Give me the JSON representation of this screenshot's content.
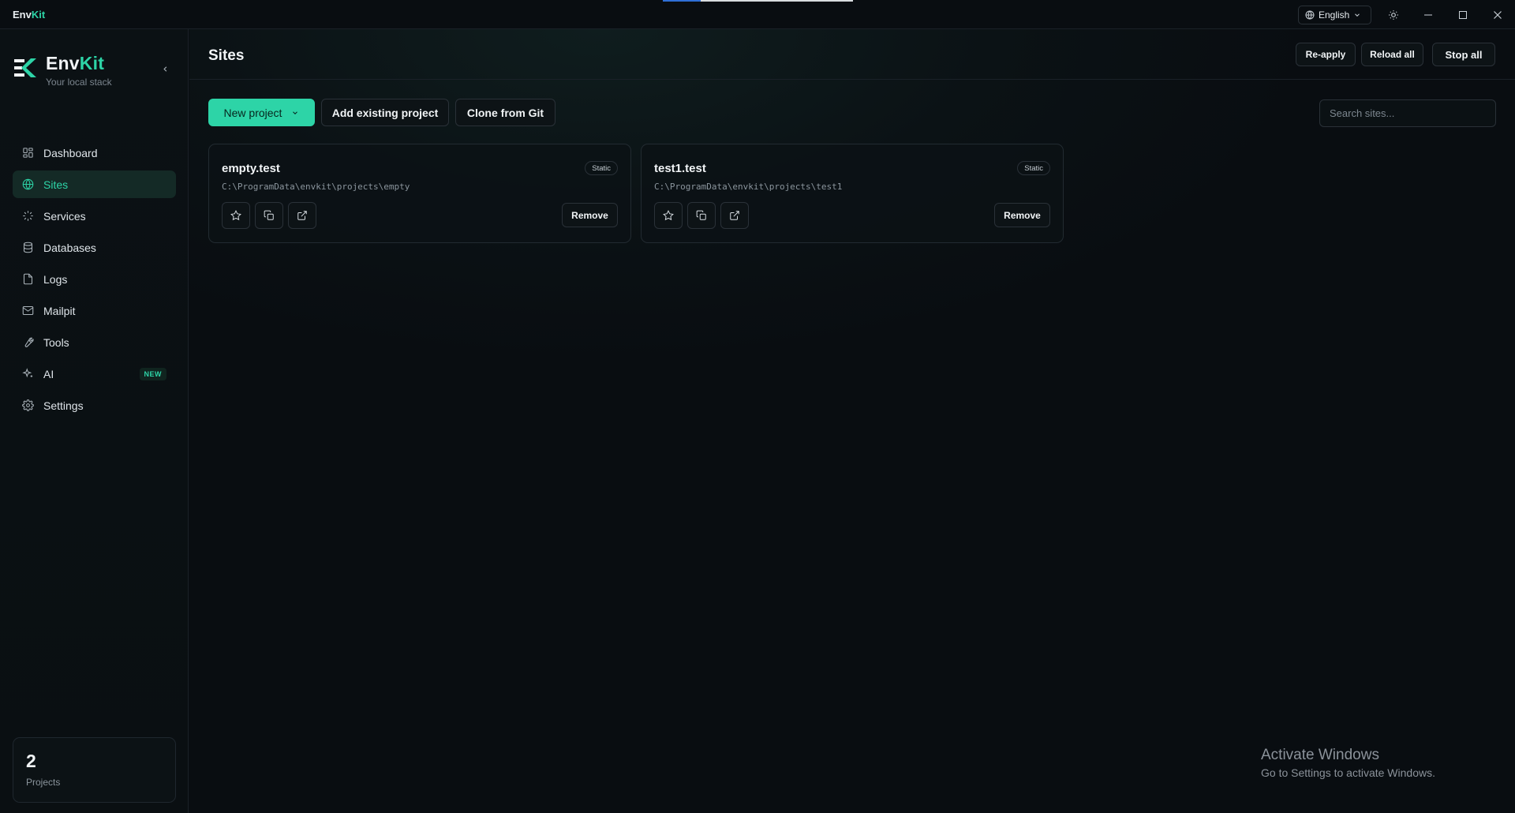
{
  "titlebar": {
    "app_name_prefix": "Env",
    "app_name_suffix": "Kit",
    "language": "English"
  },
  "sidebar": {
    "brand_prefix": "Env",
    "brand_suffix": "Kit",
    "tagline": "Your local stack",
    "items": [
      {
        "label": "Dashboard",
        "icon": "grid-icon"
      },
      {
        "label": "Sites",
        "icon": "globe-icon",
        "active": true
      },
      {
        "label": "Services",
        "icon": "loader-icon"
      },
      {
        "label": "Databases",
        "icon": "database-icon"
      },
      {
        "label": "Logs",
        "icon": "file-icon"
      },
      {
        "label": "Mailpit",
        "icon": "mail-icon"
      },
      {
        "label": "Tools",
        "icon": "wrench-icon"
      },
      {
        "label": "AI",
        "icon": "sparkles-icon",
        "badge": "NEW"
      },
      {
        "label": "Settings",
        "icon": "gear-icon"
      }
    ],
    "projects": {
      "count": "2",
      "label": "Projects"
    }
  },
  "header": {
    "title": "Sites",
    "reapply_label": "Re-apply",
    "reload_label": "Reload all",
    "stop_label": "Stop all"
  },
  "toolbar": {
    "new_project_label": "New project",
    "add_existing_label": "Add existing project",
    "clone_label": "Clone from Git",
    "search_placeholder": "Search sites..."
  },
  "sites": [
    {
      "name": "empty.test",
      "path": "C:\\ProgramData\\envkit\\projects\\empty",
      "type": "Static",
      "remove_label": "Remove"
    },
    {
      "name": "test1.test",
      "path": "C:\\ProgramData\\envkit\\projects\\test1",
      "type": "Static",
      "remove_label": "Remove"
    }
  ],
  "watermark": {
    "line1": "Activate Windows",
    "line2": "Go to Settings to activate Windows."
  },
  "colors": {
    "accent": "#2dd4a7",
    "background": "#090d11"
  }
}
